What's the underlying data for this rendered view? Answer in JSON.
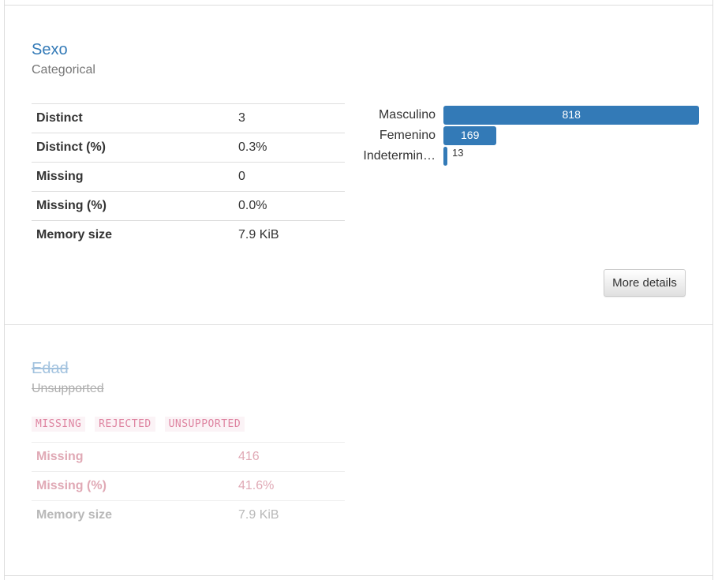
{
  "variables": [
    {
      "title": "Sexo",
      "type": "Categorical",
      "stats": [
        {
          "label": "Distinct",
          "value": "3"
        },
        {
          "label": "Distinct (%)",
          "value": "0.3%"
        },
        {
          "label": "Missing",
          "value": "0"
        },
        {
          "label": "Missing (%)",
          "value": "0.0%"
        },
        {
          "label": "Memory size",
          "value": "7.9 KiB"
        }
      ],
      "frequency": [
        {
          "label": "Masculino",
          "value": 818,
          "value_text": "818"
        },
        {
          "label": "Femenino",
          "value": 169,
          "value_text": "169"
        },
        {
          "label": "Indetermin…",
          "value": 13,
          "value_text": "13"
        }
      ],
      "more_details_label": "More details"
    },
    {
      "title": "Edad",
      "type": "Unsupported",
      "badges": [
        "MISSING",
        "REJECTED",
        "UNSUPPORTED"
      ],
      "stats": [
        {
          "label": "Missing",
          "value": "416"
        },
        {
          "label": "Missing (%)",
          "value": "41.6%"
        },
        {
          "label": "Memory size",
          "value": "7.9 KiB"
        }
      ]
    }
  ],
  "colors": {
    "accent": "#337ab7",
    "badge_text": "#d96e90",
    "badge_bg": "#fbf2f5"
  }
}
